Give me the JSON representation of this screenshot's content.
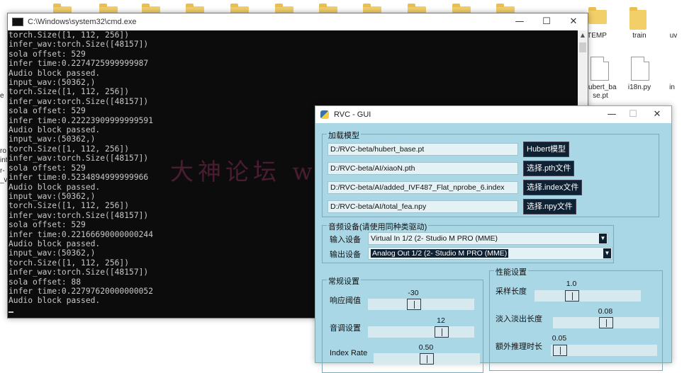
{
  "desktop": {
    "labels": [
      "TEMP",
      "train",
      "uv",
      "hubert_ba\nse.pt",
      "i18n.py",
      "in"
    ],
    "edge_fragments": [
      "e",
      "ro",
      "ints",
      "r-",
      "_v"
    ]
  },
  "cmd": {
    "title": "C:\\Windows\\system32\\cmd.exe",
    "minimize": "—",
    "maximize": "☐",
    "close": "✕",
    "lines": [
      "torch.Size([1, 112, 256])",
      "infer_wav:torch.Size([48157])",
      "sola offset: 529",
      "infer time:0.2274725999999987",
      "Audio block passed.",
      "input_wav:(50362,)",
      "torch.Size([1, 112, 256])",
      "infer_wav:torch.Size([48157])",
      "sola offset: 529",
      "infer time:0.22223909999999591",
      "Audio block passed.",
      "input_wav:(50362,)",
      "torch.Size([1, 112, 256])",
      "infer_wav:torch.Size([48157])",
      "sola offset: 529",
      "infer time:0.5234894999999966",
      "Audio block passed.",
      "input_wav:(50362,)",
      "torch.Size([1, 112, 256])",
      "infer_wav:torch.Size([48157])",
      "sola offset: 529",
      "infer time:0.22166690000000244",
      "Audio block passed.",
      "input_wav:(50362,)",
      "torch.Size([1, 112, 256])",
      "infer_wav:torch.Size([48157])",
      "sola offset: 88",
      "infer time:0.22797620000000052",
      "Audio block passed."
    ]
  },
  "watermark": "大神论坛  www.dslt.tech",
  "rvc": {
    "title": "RVC - GUI",
    "minimize": "—",
    "maximize": "☐",
    "close": "✕",
    "model_frame": {
      "title": "加载模型",
      "hubert_path": "D:/RVC-beta/hubert_base.pt",
      "hubert_button": "Hubert模型",
      "pth_path": "D:/RVC-beta/AI/xiaoN.pth",
      "pth_button": "选择.pth文件",
      "index_path": "D:/RVC-beta/AI/added_IVF487_Flat_nprobe_6.index",
      "index_button": "选择.index文件",
      "npy_path": "D:/RVC-beta/AI/total_fea.npy",
      "npy_button": "选择.npy文件"
    },
    "audio_frame": {
      "title": "音频设备(请使用同种类驱动)",
      "input_label": "输入设备",
      "input_value": "Virtual In 1/2 (2- Studio M PRO (MME)",
      "output_label": "输出设备",
      "output_value": "Analog Out 1/2 (2- Studio M PRO (MME)"
    },
    "general_frame": {
      "title": "常规设置",
      "threshold_label": "响应阈值",
      "threshold_value": "-30",
      "threshold_level": 0.42,
      "pitch_label": "音调设置",
      "pitch_value": "12",
      "pitch_level": 0.72,
      "index_rate_label": "Index Rate",
      "index_rate_value": "0.50",
      "index_rate_level": 0.5
    },
    "perf_frame": {
      "title": "性能设置",
      "sample_label": "采样长度",
      "sample_value": "1.0",
      "sample_level": 0.33,
      "fade_label": "淡入淡出长度",
      "fade_value": "0.08",
      "fade_level": 0.5,
      "extra_label": "额外推理时长",
      "extra_value": "0.05",
      "extra_level": 0.02
    }
  }
}
